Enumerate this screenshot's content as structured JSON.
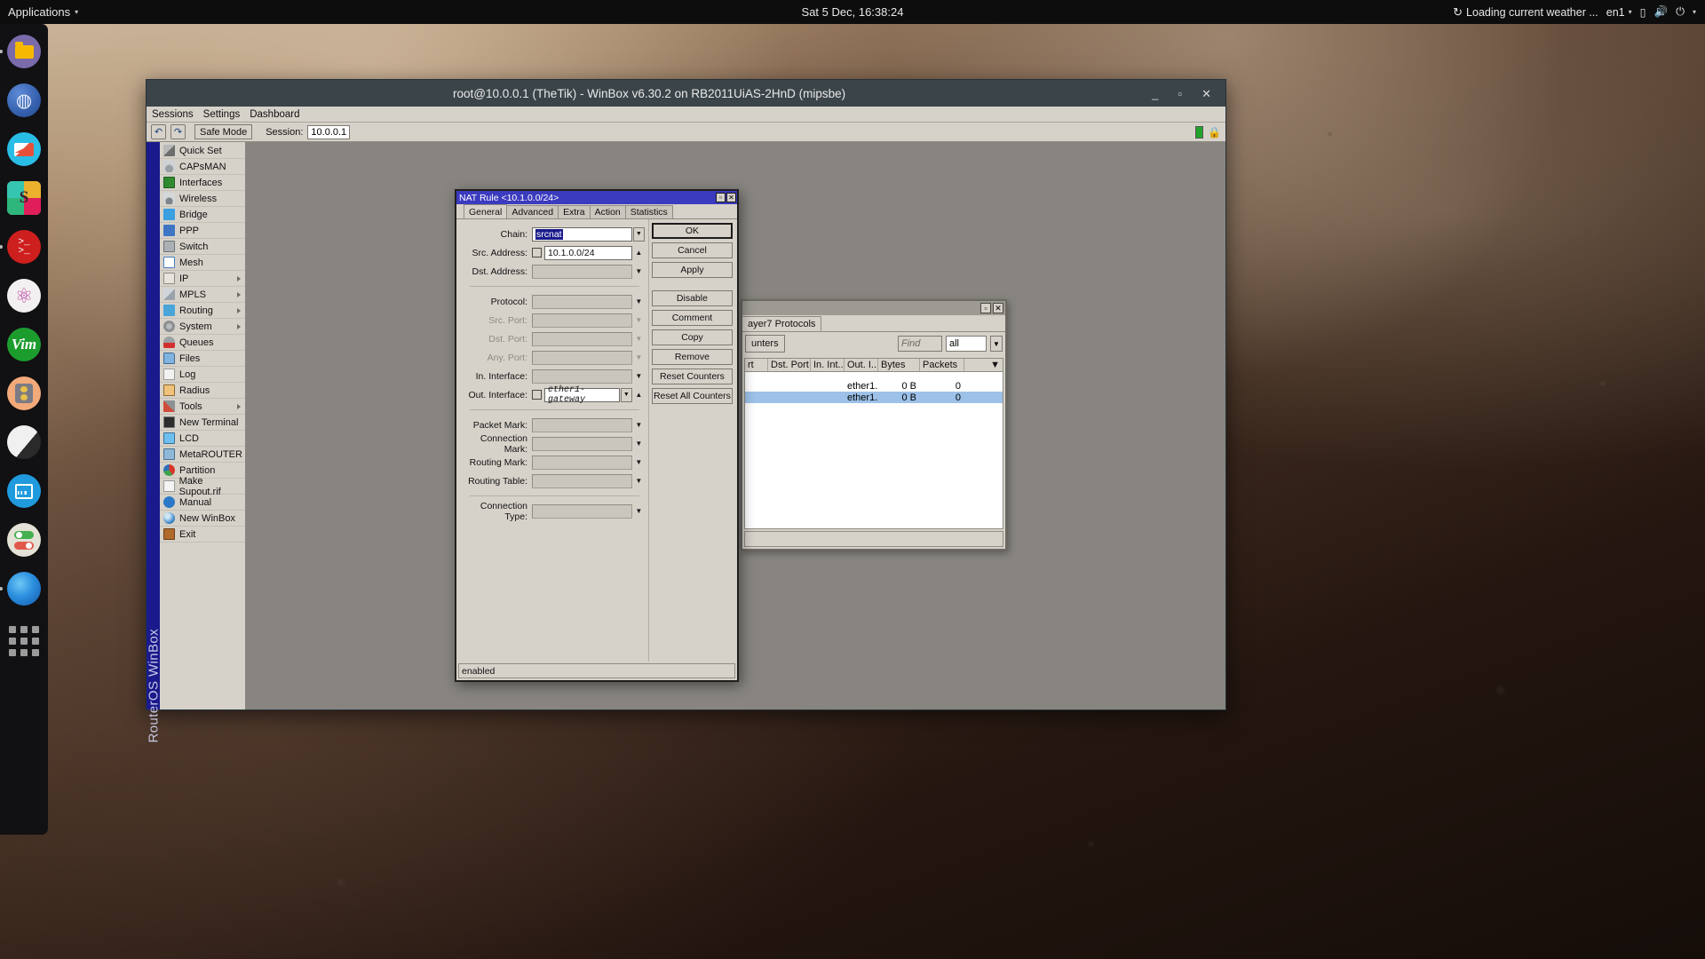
{
  "topbar": {
    "applications": "Applications",
    "clock": "Sat  5 Dec, 16:38:24",
    "weather": "Loading current weather ...",
    "keyboard": "en1",
    "icons": {
      "spinner": "↻",
      "battery": "▯",
      "volume": "🔊",
      "power": "⏻",
      "caret": "▾"
    }
  },
  "dock": {
    "items": [
      {
        "name": "files",
        "running": true
      },
      {
        "name": "browser",
        "running": false
      },
      {
        "name": "mail",
        "running": false
      },
      {
        "name": "slack",
        "running": false
      },
      {
        "name": "terminal",
        "running": true
      },
      {
        "name": "atom",
        "running": false
      },
      {
        "name": "vim",
        "running": false
      },
      {
        "name": "audio",
        "running": false
      },
      {
        "name": "moon",
        "running": false
      },
      {
        "name": "monitor",
        "running": false
      },
      {
        "name": "toggles",
        "running": false
      },
      {
        "name": "planet",
        "running": true
      },
      {
        "name": "app-grid",
        "running": false
      }
    ]
  },
  "winbox": {
    "title": "root@10.0.0.1 (TheTik) - WinBox v6.30.2 on RB2011UiAS-2HnD (mipsbe)",
    "window_controls": {
      "minimize": "_",
      "maximize": "▫",
      "close": "✕"
    },
    "menubar": [
      "Sessions",
      "Settings",
      "Dashboard"
    ],
    "toolbar": {
      "undo": "↶",
      "redo": "↷",
      "safe_mode": "Safe Mode",
      "session_label": "Session:",
      "session_value": "10.0.0.1"
    },
    "vertical_label": "RouterOS WinBox",
    "menu": [
      {
        "label": "Quick Set",
        "icon": "quickset-icon",
        "submenu": false
      },
      {
        "label": "CAPsMAN",
        "icon": "capsman-icon",
        "submenu": false
      },
      {
        "label": "Interfaces",
        "icon": "interfaces-icon",
        "submenu": false
      },
      {
        "label": "Wireless",
        "icon": "wireless-icon",
        "submenu": false
      },
      {
        "label": "Bridge",
        "icon": "bridge-icon",
        "submenu": false
      },
      {
        "label": "PPP",
        "icon": "ppp-icon",
        "submenu": false
      },
      {
        "label": "Switch",
        "icon": "switch-icon",
        "submenu": false
      },
      {
        "label": "Mesh",
        "icon": "mesh-icon",
        "submenu": false
      },
      {
        "label": "IP",
        "icon": "ip-icon",
        "submenu": true
      },
      {
        "label": "MPLS",
        "icon": "mpls-icon",
        "submenu": true
      },
      {
        "label": "Routing",
        "icon": "routing-icon",
        "submenu": true
      },
      {
        "label": "System",
        "icon": "system-icon",
        "submenu": true
      },
      {
        "label": "Queues",
        "icon": "queues-icon",
        "submenu": false
      },
      {
        "label": "Files",
        "icon": "files-icon",
        "submenu": false
      },
      {
        "label": "Log",
        "icon": "log-icon",
        "submenu": false
      },
      {
        "label": "Radius",
        "icon": "radius-icon",
        "submenu": false
      },
      {
        "label": "Tools",
        "icon": "tools-icon",
        "submenu": true
      },
      {
        "label": "New Terminal",
        "icon": "terminal-icon",
        "submenu": false
      },
      {
        "label": "LCD",
        "icon": "lcd-icon",
        "submenu": false
      },
      {
        "label": "MetaROUTER",
        "icon": "metarouter-icon",
        "submenu": false
      },
      {
        "label": "Partition",
        "icon": "partition-icon",
        "submenu": false
      },
      {
        "label": "Make Supout.rif",
        "icon": "supout-icon",
        "submenu": false
      },
      {
        "label": "Manual",
        "icon": "manual-icon",
        "submenu": false
      },
      {
        "label": "New WinBox",
        "icon": "winbox-icon",
        "submenu": false
      },
      {
        "label": "Exit",
        "icon": "exit-icon",
        "submenu": false
      }
    ]
  },
  "firewall_window": {
    "window_controls": {
      "maximize": "▫",
      "close": "✕"
    },
    "tab": "ayer7 Protocols",
    "toolbar": {
      "reset_counters": "unters",
      "find_placeholder": "Find",
      "filter_value": "all",
      "filter_caret": "▼"
    },
    "columns": [
      "rt",
      "Dst. Port",
      "In. Int...",
      "Out. I...",
      "Bytes",
      "Packets",
      ""
    ],
    "rows": [
      {
        "src_port": "",
        "dst_port": "",
        "in_interface": "",
        "out_interface": "ether1...",
        "bytes": "0 B",
        "packets": "0",
        "selected": false
      },
      {
        "src_port": "",
        "dst_port": "",
        "in_interface": "",
        "out_interface": "ether1...",
        "bytes": "0 B",
        "packets": "0",
        "selected": true
      }
    ]
  },
  "nat_dialog": {
    "title": "NAT Rule <10.1.0.0/24>",
    "window_controls": {
      "maximize": "▫",
      "close": "✕"
    },
    "tabs": [
      {
        "label": "General",
        "active": true
      },
      {
        "label": "Advanced",
        "active": false
      },
      {
        "label": "Extra",
        "active": false
      },
      {
        "label": "Action",
        "active": false
      },
      {
        "label": "Statistics",
        "active": false
      }
    ],
    "fields": [
      {
        "label": "Chain:",
        "value": "srcnat",
        "state": "selected-text",
        "checkbox": false,
        "control": "dropdown-btn"
      },
      {
        "label": "Src. Address:",
        "value": "10.1.0.0/24",
        "state": "editable",
        "checkbox": true,
        "control": "caret-up"
      },
      {
        "label": "Dst. Address:",
        "value": "",
        "state": "empty",
        "checkbox": false,
        "control": "caret-down"
      },
      {
        "label": "Protocol:",
        "value": "",
        "state": "empty",
        "checkbox": false,
        "control": "caret-down"
      },
      {
        "label": "Src. Port:",
        "value": "",
        "state": "disabled",
        "checkbox": false,
        "control": "caret-down-dim"
      },
      {
        "label": "Dst. Port:",
        "value": "",
        "state": "disabled",
        "checkbox": false,
        "control": "caret-down-dim"
      },
      {
        "label": "Any. Port:",
        "value": "",
        "state": "disabled",
        "checkbox": false,
        "control": "caret-down-dim"
      },
      {
        "label": "In. Interface:",
        "value": "",
        "state": "empty",
        "checkbox": false,
        "control": "caret-down"
      },
      {
        "label": "Out. Interface:",
        "value": "ether1-gateway",
        "state": "editable-italic",
        "checkbox": true,
        "control": "dropdown-caret-up"
      },
      {
        "label": "Packet Mark:",
        "value": "",
        "state": "empty",
        "checkbox": false,
        "control": "caret-down"
      },
      {
        "label": "Connection Mark:",
        "value": "",
        "state": "empty",
        "checkbox": false,
        "control": "caret-down"
      },
      {
        "label": "Routing Mark:",
        "value": "",
        "state": "empty",
        "checkbox": false,
        "control": "caret-down"
      },
      {
        "label": "Routing Table:",
        "value": "",
        "state": "empty",
        "checkbox": false,
        "control": "caret-down"
      },
      {
        "label": "Connection Type:",
        "value": "",
        "state": "empty",
        "checkbox": false,
        "control": "caret-down"
      }
    ],
    "buttons": [
      {
        "label": "OK",
        "default": true
      },
      {
        "label": "Cancel",
        "default": false
      },
      {
        "label": "Apply",
        "default": false
      },
      {
        "label": "Disable",
        "default": false
      },
      {
        "label": "Comment",
        "default": false
      },
      {
        "label": "Copy",
        "default": false
      },
      {
        "label": "Remove",
        "default": false
      },
      {
        "label": "Reset Counters",
        "default": false
      },
      {
        "label": "Reset All Counters",
        "default": false
      }
    ],
    "status": "enabled"
  }
}
